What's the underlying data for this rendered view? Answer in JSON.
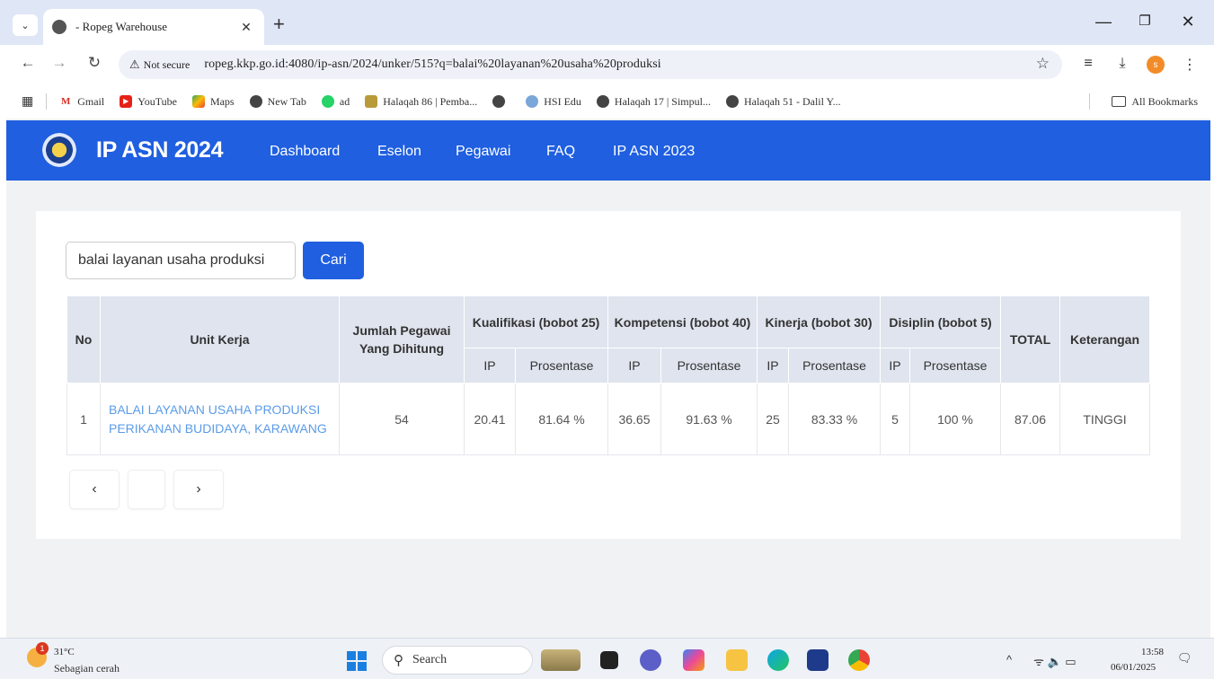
{
  "browser": {
    "tab_search_glyph": "⌄",
    "tab_title": "- Ropeg Warehouse",
    "tab_close": "✕",
    "new_tab": "+",
    "minimize": "—",
    "restore": "❐",
    "close": "✕",
    "back": "←",
    "forward": "→",
    "reload": "↻",
    "security_icon": "⚠",
    "security_label": "Not secure",
    "url": "ropeg.kkp.go.id:4080/ip-asn/2024/unker/515?q=balai%20layanan%20usaha%20produksi",
    "star": "☆",
    "media_icon": "≡",
    "download_icon": "⤓",
    "profile_letter": "s",
    "menu_icon": "⋮"
  },
  "bookmarks": {
    "apps_icon": "▦",
    "items": [
      "Gmail",
      "YouTube",
      "Maps",
      "New Tab",
      "ad",
      "Halaqah 86 | Pemba...",
      "",
      "HSI Edu",
      "Halaqah 17 | Simpul...",
      "Halaqah 51 - Dalil Y..."
    ],
    "all_label": "All Bookmarks"
  },
  "navbar": {
    "brand": "IP ASN 2024",
    "links": [
      "Dashboard",
      "Eselon",
      "Pegawai",
      "FAQ",
      "IP ASN 2023"
    ]
  },
  "search": {
    "value": "balai layanan usaha produksi",
    "button": "Cari"
  },
  "table": {
    "headers": {
      "no": "No",
      "unit": "Unit Kerja",
      "jumlah": "Jumlah Pegawai Yang Dihitung",
      "kualifikasi": "Kualifikasi (bobot 25)",
      "kompetensi": "Kompetensi (bobot 40)",
      "kinerja": "Kinerja (bobot 30)",
      "disiplin": "Disiplin (bobot 5)",
      "total": "TOTAL",
      "keterangan": "Keterangan",
      "ip": "IP",
      "prosentase": "Prosentase"
    },
    "rows": [
      {
        "no": "1",
        "unit": "BALAI LAYANAN USAHA PRODUKSI PERIKANAN BUDIDAYA, KARAWANG",
        "jumlah": "54",
        "kual_ip": "20.41",
        "kual_pct": "81.64 %",
        "komp_ip": "36.65",
        "komp_pct": "91.63 %",
        "kin_ip": "25",
        "kin_pct": "83.33 %",
        "dis_ip": "5",
        "dis_pct": "100 %",
        "total": "87.06",
        "keterangan": "TINGGI"
      }
    ]
  },
  "pagination": {
    "prev": "‹",
    "current": "",
    "next": "›"
  },
  "taskbar": {
    "weather_badge": "1",
    "temperature": "31°C",
    "condition": "Sebagian cerah",
    "search_glyph": "⚲",
    "search_label": "Search",
    "tray_chevron": "^",
    "tray_icons": "ᯤ 🔈 ▭",
    "time": "13:58",
    "date": "06/01/2025",
    "notification_icon": "🗨"
  },
  "colors": {
    "navbar": "#1f5fe0",
    "link": "#5b9be8",
    "header_bg": "#dfe4ee"
  }
}
